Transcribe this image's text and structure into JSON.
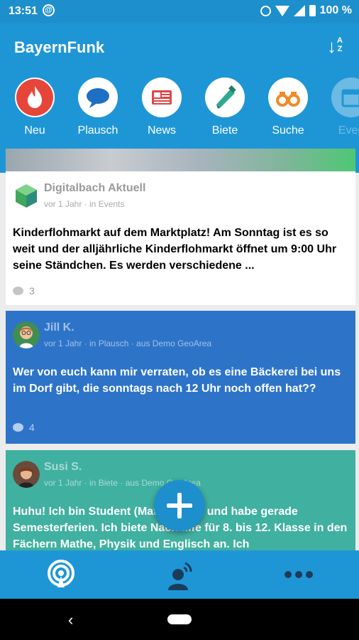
{
  "status": {
    "time": "13:51",
    "battery": "100 %"
  },
  "app": {
    "title": "BayernFunk"
  },
  "categories": [
    {
      "label": "Neu",
      "icon": "flame-icon"
    },
    {
      "label": "Plausch",
      "icon": "chat-bubble-icon"
    },
    {
      "label": "News",
      "icon": "newspaper-icon"
    },
    {
      "label": "Biete",
      "icon": "saw-icon"
    },
    {
      "label": "Suche",
      "icon": "binoculars-icon"
    },
    {
      "label": "Even",
      "icon": "calendar-icon"
    }
  ],
  "posts": [
    {
      "author": "Digitalbach Aktuell",
      "meta": "vor 1 Jahr · in Events",
      "body": "Kinderflohmarkt auf dem Marktplatz! Am Sonntag ist es so weit und der alljährliche Kinderflohmarkt öffnet um 9:00 Uhr seine Ständchen. Es werden verschiedene ...",
      "comments": "3"
    },
    {
      "author": "Jill K.",
      "meta": "vor 1 Jahr · in Plausch · aus Demo GeoArea",
      "body": "Wer von euch kann mir verraten, ob es eine Bäckerei bei uns im Dorf gibt, die sonntags nach 12 Uhr noch offen hat??",
      "comments": "4"
    },
    {
      "author": "Susi S.",
      "meta": "vor 1 Jahr · in Biete · aus Demo GeoArea",
      "body": "Huhu! Ich bin Student (Mathematik) und habe gerade Semesterferien. Ich biete Nachhilfe für 8. bis 12. Klasse in den Fächern Mathe, Physik und Englisch an. Ich",
      "comments": ""
    }
  ],
  "colors": {
    "primary": "#1e96d6",
    "card_blue": "#2d74c9",
    "card_teal": "#40b0a1"
  },
  "nav": {
    "icons": [
      "broadcast-icon",
      "profile-signal-icon",
      "more-dots-icon"
    ]
  }
}
